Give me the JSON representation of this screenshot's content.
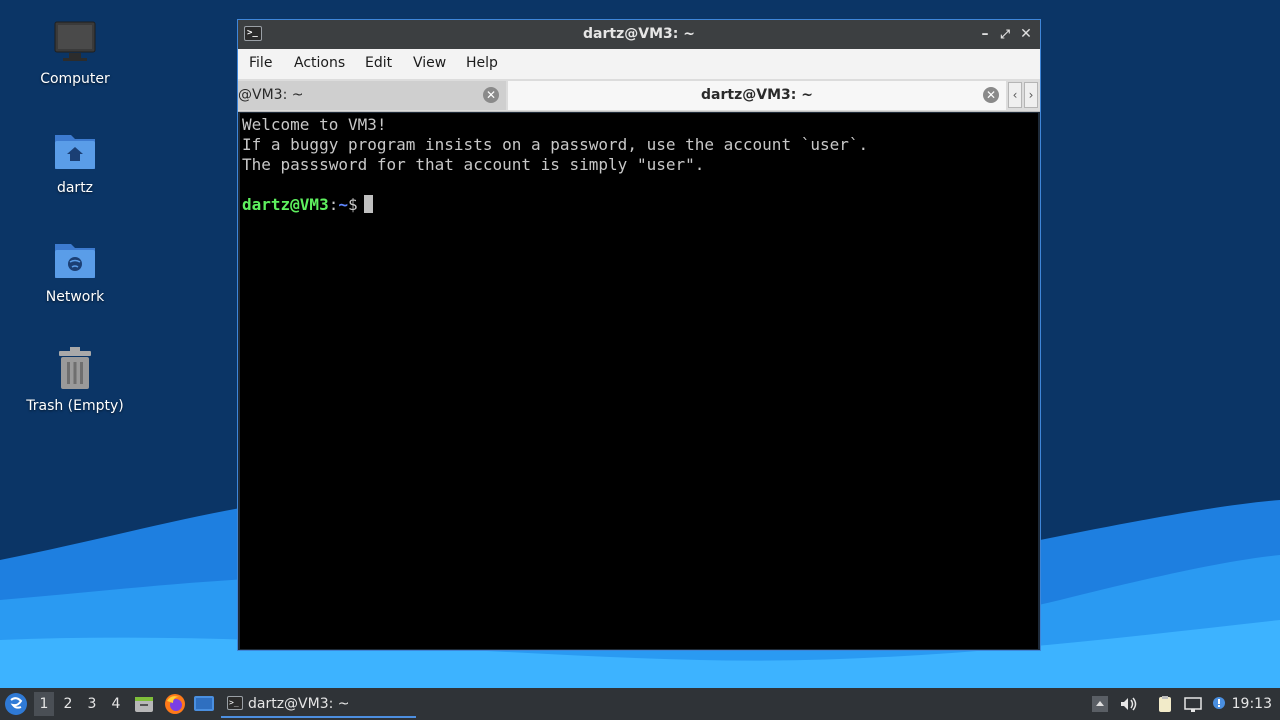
{
  "desktop": {
    "icons": [
      {
        "label": "Computer",
        "icon": "computer-icon"
      },
      {
        "label": "dartz",
        "icon": "home-folder-icon"
      },
      {
        "label": "Network",
        "icon": "network-folder-icon"
      },
      {
        "label": "Trash (Empty)",
        "icon": "trash-icon"
      }
    ]
  },
  "window": {
    "title": "dartz@VM3: ~",
    "menu": [
      "File",
      "Actions",
      "Edit",
      "View",
      "Help"
    ],
    "tabs": [
      {
        "label": "@VM3: ~",
        "active": false
      },
      {
        "label": "dartz@VM3: ~",
        "active": true
      }
    ],
    "terminal": {
      "lines": [
        "Welcome to VM3!",
        "If a buggy program insists on a password, use the account `user`.",
        "The passsword for that account is simply \"user\"."
      ],
      "prompt_user": "dartz@VM3",
      "prompt_colon": ":",
      "prompt_path": "~",
      "prompt_symbol": "$"
    }
  },
  "taskbar": {
    "workspaces": [
      "1",
      "2",
      "3",
      "4"
    ],
    "active_task": "dartz@VM3: ~",
    "clock": "19:13"
  },
  "colors": {
    "accent": "#3f86d9",
    "prompt_user": "#5ef05e",
    "prompt_path": "#5f87ff"
  }
}
